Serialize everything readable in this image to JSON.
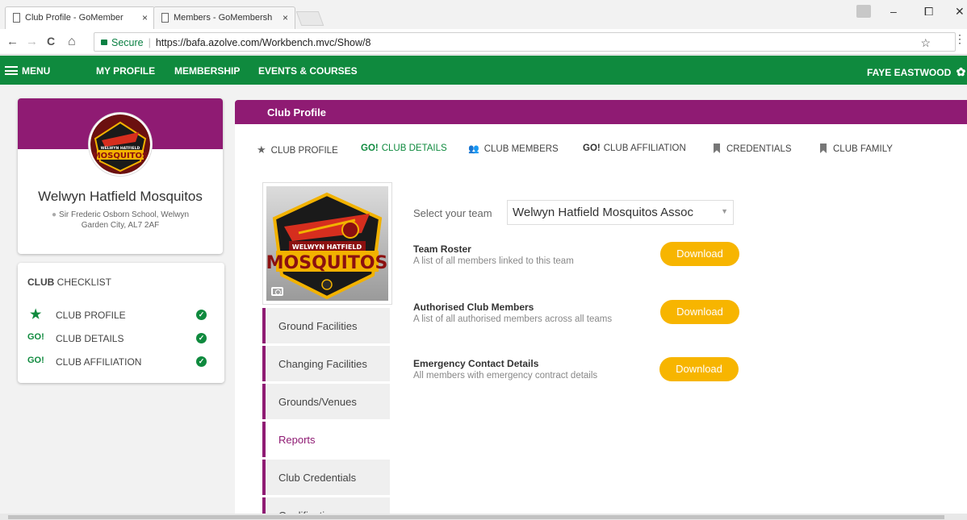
{
  "browser": {
    "tabs": [
      {
        "title": "Club Profile - GoMember",
        "close": "×"
      },
      {
        "title": "Members - GoMembersh",
        "close": "×"
      }
    ],
    "window": {
      "minimize": "–",
      "maximize": "⧠",
      "close": "✕"
    },
    "nav": {
      "back": "←",
      "forward": "→",
      "reload": "C",
      "home": "⌂"
    },
    "secure_label": "Secure",
    "separator": "|",
    "url": "https://bafa.azolve.com/Workbench.mvc/Show/8",
    "bookmark": "☆",
    "menu": "⋮"
  },
  "appnav": {
    "menu": "MENU",
    "links": [
      "MY PROFILE",
      "MEMBERSHIP",
      "EVENTS & COURSES"
    ],
    "user": "FAYE EASTWOOD",
    "gear": "✿"
  },
  "club": {
    "name": "Welwyn Hatfield Mosquitos",
    "address": "Sir Frederic Osborn School, Welwyn Garden City, AL7 2AF",
    "pin": "⬤",
    "logo_text_top": "WELWYN HATFIELD",
    "logo_text_main": "MOSQUITOS"
  },
  "checklist": {
    "title_bold": "CLUB",
    "title_rest": " CHECKLIST",
    "items": [
      {
        "icon": "★",
        "label": "CLUB PROFILE",
        "tick": "✓"
      },
      {
        "icon": "GO!",
        "label": "CLUB DETAILS",
        "tick": "✓"
      },
      {
        "icon": "GO!",
        "label": "CLUB AFFILIATION",
        "tick": "✓"
      }
    ]
  },
  "main": {
    "title": "Club Profile",
    "tabs": [
      {
        "icon": "★",
        "label": "CLUB PROFILE"
      },
      {
        "icon": "GO!",
        "label": "CLUB DETAILS"
      },
      {
        "icon": "👥",
        "label": "CLUB MEMBERS"
      },
      {
        "icon": "GO!",
        "label": "CLUB AFFILIATION"
      },
      {
        "icon": "",
        "label": "CREDENTIALS"
      },
      {
        "icon": "",
        "label": "CLUB FAMILY"
      }
    ],
    "side_menu": [
      "Ground Facilities",
      "Changing Facilities",
      "Grounds/Venues",
      "Reports",
      "Club Credentials",
      "Qualifications"
    ],
    "team_label": "Select your team",
    "team_value": "Welwyn Hatfield Mosquitos Assoc",
    "team_caret": "▼",
    "reports": [
      {
        "title": "Team Roster",
        "desc": "A list of all members linked to this team",
        "button": "Download"
      },
      {
        "title": "Authorised Club Members",
        "desc": "A list of all authorised members across all teams",
        "button": "Download"
      },
      {
        "title": "Emergency Contact Details",
        "desc": "All members with emergency contract details",
        "button": "Download"
      }
    ]
  },
  "colors": {
    "primary": "#8f1b73",
    "nav_green": "#0f8a3e",
    "button": "#f7b500"
  }
}
